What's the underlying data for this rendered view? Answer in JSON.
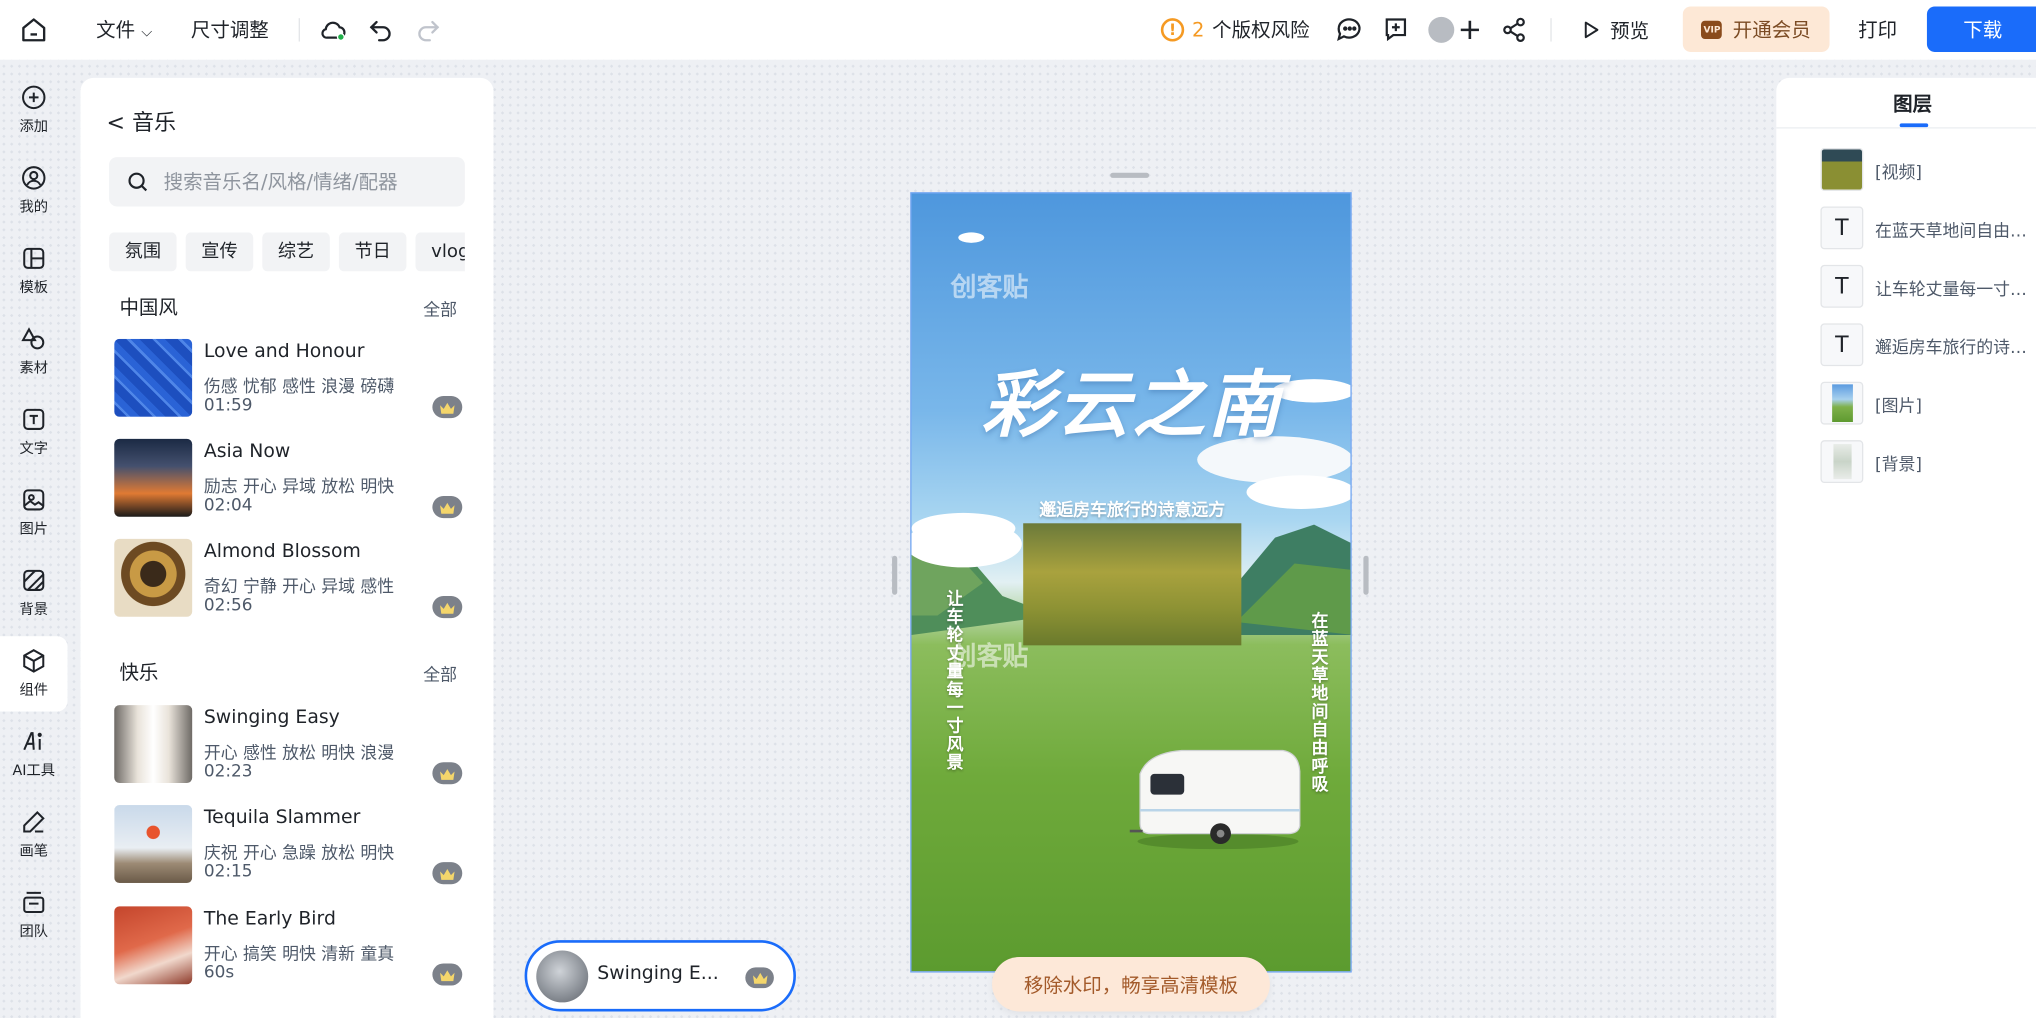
{
  "topbar": {
    "file_menu": "文件",
    "resize_menu": "尺寸调整",
    "copyright_count": "2",
    "copyright_label": "个版权风险",
    "preview": "预览",
    "vip": "开通会员",
    "vip_badge": "VIP",
    "print": "打印",
    "download": "下载"
  },
  "rail": [
    {
      "label": "添加",
      "icon": "plus-circle-icon"
    },
    {
      "label": "我的",
      "icon": "user-icon"
    },
    {
      "label": "模板",
      "icon": "template-icon"
    },
    {
      "label": "素材",
      "icon": "shapes-icon"
    },
    {
      "label": "文字",
      "icon": "text-icon"
    },
    {
      "label": "图片",
      "icon": "image-icon"
    },
    {
      "label": "背景",
      "icon": "background-icon"
    },
    {
      "label": "组件",
      "icon": "component-icon"
    },
    {
      "label": "AI工具",
      "icon": "ai-icon"
    },
    {
      "label": "画笔",
      "icon": "brush-icon"
    },
    {
      "label": "团队",
      "icon": "team-icon"
    }
  ],
  "music": {
    "title": "< 音乐",
    "search_placeholder": "搜索音乐名/风格/情绪/配器",
    "tags": [
      "氛围",
      "宣传",
      "综艺",
      "节日",
      "vlog"
    ],
    "sections": [
      {
        "title": "中国风",
        "all": "全部",
        "tracks": [
          {
            "name": "Love and Honour",
            "tags": "伤感 忧郁 感性 浪漫 磅礴",
            "duration": "01:59"
          },
          {
            "name": "Asia Now",
            "tags": "励志 开心 异域 放松 明快",
            "duration": "02:04"
          },
          {
            "name": "Almond Blossom",
            "tags": "奇幻 宁静 开心 异域 感性",
            "duration": "02:56"
          }
        ]
      },
      {
        "title": "快乐",
        "all": "全部",
        "tracks": [
          {
            "name": "Swinging Easy",
            "tags": "开心 感性 放松 明快 浪漫",
            "duration": "02:23"
          },
          {
            "name": "Tequila Slammer",
            "tags": "庆祝 开心 急躁 放松 明快",
            "duration": "02:15"
          },
          {
            "name": "The Early Bird",
            "tags": "开心 搞笑 明快 清新 童真",
            "duration": "60s"
          }
        ]
      }
    ]
  },
  "player": {
    "track": "Swinging E..."
  },
  "poster": {
    "watermark": "创客贴",
    "title": "彩云之南",
    "subtitle": "邂逅房车旅行的诗意远方",
    "left_text": "让车轮丈量每一寸风景",
    "right_text": "在蓝天草地间自由呼吸"
  },
  "watermark_banner": "移除水印，畅享高清模板",
  "layers": {
    "title": "图层",
    "items": [
      {
        "type": "video",
        "label": "[视频]"
      },
      {
        "type": "text",
        "label": "在蓝天草地间自由呼吸"
      },
      {
        "type": "text",
        "label": "让车轮丈量每一寸风景"
      },
      {
        "type": "text",
        "label": "邂逅房车旅行的诗意远方"
      },
      {
        "type": "image",
        "label": "[图片]"
      },
      {
        "type": "background",
        "label": "[背景]"
      }
    ]
  },
  "colors": {
    "accent": "#1a6cfa",
    "warning": "#f59a23",
    "vip_bg": "#fde8d6"
  }
}
